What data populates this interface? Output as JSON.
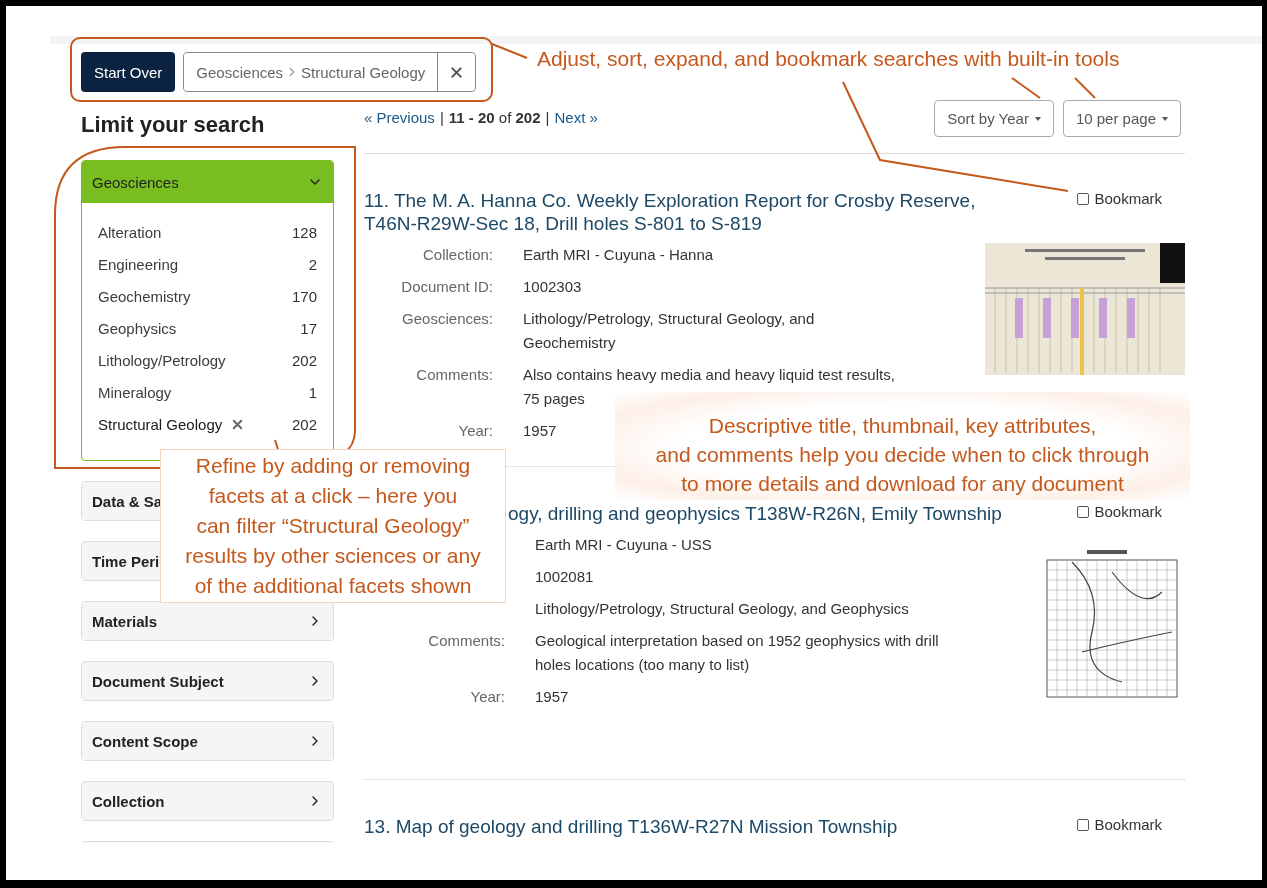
{
  "toolbar": {
    "start_over": "Start Over",
    "constraint": {
      "field": "Geosciences",
      "value": "Structural Geology"
    }
  },
  "sidebar": {
    "heading": "Limit your search",
    "facets": [
      {
        "label": "Geosciences",
        "expanded": true,
        "items": [
          {
            "label": "Alteration",
            "count": "128",
            "selected": false
          },
          {
            "label": "Engineering",
            "count": "2",
            "selected": false
          },
          {
            "label": "Geochemistry",
            "count": "170",
            "selected": false
          },
          {
            "label": "Geophysics",
            "count": "17",
            "selected": false
          },
          {
            "label": "Lithology/Petrology",
            "count": "202",
            "selected": false
          },
          {
            "label": "Mineralogy",
            "count": "1",
            "selected": false
          },
          {
            "label": "Structural Geology",
            "count": "202",
            "selected": true
          }
        ]
      },
      {
        "label": "Data & Sa",
        "expanded": false
      },
      {
        "label": "Time Peri",
        "expanded": false
      },
      {
        "label": "Materials",
        "expanded": false
      },
      {
        "label": "Document Subject",
        "expanded": false
      },
      {
        "label": "Content Scope",
        "expanded": false
      },
      {
        "label": "Collection",
        "expanded": false
      },
      {
        "expanded": false
      }
    ]
  },
  "pagination": [
    {
      "kind": "link",
      "text": "« Previous"
    },
    {
      "kind": "separator",
      "text": "|"
    },
    {
      "kind": "range",
      "text": "**11 - 20** of **202**"
    },
    {
      "kind": "separator",
      "text": "|"
    },
    {
      "kind": "link",
      "text": "Next »"
    }
  ],
  "sort_controls": [
    {
      "label": "Sort by Year"
    },
    {
      "label": "10 per page"
    }
  ],
  "results": [
    {
      "title": "11. The M. A. Hanna Co. Weekly Exploration Report for Crosby Reserve, T46N-R29W-Sec 18, Drill holes S-801 to S-819",
      "bookmark": {
        "label": "Bookmark",
        "checked": false
      },
      "kind": "document",
      "fields": [
        {
          "label": "Collection:",
          "value": "Earth MRI - Cuyuna - Hanna"
        },
        {
          "label": "Document ID:",
          "value": "1002303"
        },
        {
          "label": "Geosciences:",
          "value": "Lithology/Petrology, Structural Geology, and\nGeochemistry"
        },
        {
          "label": "Comments:",
          "value": "Also contains heavy media and heavy liquid test results,\n75 pages"
        },
        {
          "label": "Year:",
          "value": "1957"
        }
      ]
    },
    {
      "title": "ogy, drilling and geophysics T138W-R26N, Emily Township",
      "bookmark": {
        "label": "Bookmark",
        "checked": false
      },
      "kind": "map",
      "fields": [
        {
          "value": "Earth MRI - Cuyuna - USS"
        },
        {
          "value": "1002081"
        },
        {
          "value": "Lithology/Petrology, Structural Geology, and Geophysics"
        },
        {
          "label": "Comments:",
          "value": "Geological interpretation based on 1952 geophysics with drill\nholes locations (too many to list)"
        },
        {
          "label": "Year:",
          "value": "1957"
        }
      ]
    },
    {
      "title": "13. Map of geology and drilling T136W-R27N Mission Township",
      "bookmark": {
        "label": "Bookmark",
        "checked": false
      }
    }
  ],
  "callouts": [
    {
      "kind": "banner",
      "text": "Adjust, sort, expand, and bookmark searches with built-in tools"
    },
    {
      "kind": "box",
      "text": "Refine by adding or removing\nfacets at a click – here you\ncan filter “Structural Geology”\nresults by other sciences or any\nof the additional facets shown"
    },
    {
      "kind": "glow",
      "text": "Descriptive title, thumbnail, key attributes,\nand comments help you decide when to click through\nto more details and download for any document"
    }
  ]
}
